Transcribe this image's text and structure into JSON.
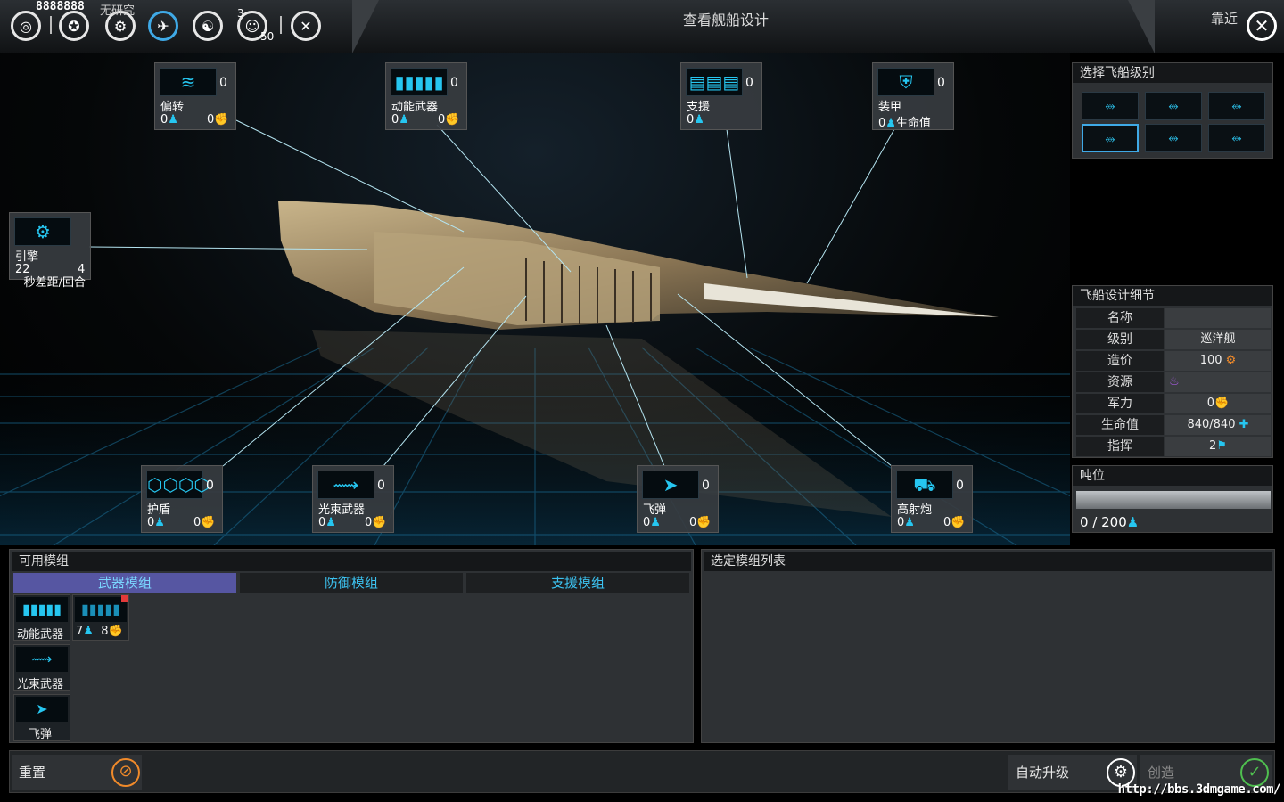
{
  "topbar": {
    "credits": "8888888",
    "research_label": "无研究",
    "badge_a": "3",
    "badge_b": "50",
    "title": "查看舰船设计",
    "approach": "靠近",
    "close_icon": "✕"
  },
  "slots": {
    "deflect": {
      "count": "0",
      "name": "偏转",
      "v1": "0",
      "v2": "0"
    },
    "kinetic": {
      "count": "0",
      "name": "动能武器",
      "v1": "0",
      "v2": "0"
    },
    "support": {
      "count": "0",
      "name": "支援",
      "v1": "0"
    },
    "armor": {
      "count": "0",
      "name": "装甲",
      "v1": "0",
      "v1_suffix": "生命值"
    },
    "engine": {
      "name": "引擎",
      "v1": "22",
      "v2": "4",
      "unit": "秒差距/回合"
    },
    "shield": {
      "count": "0",
      "name": "护盾",
      "v1": "0",
      "v2": "0"
    },
    "beam": {
      "count": "0",
      "name": "光束武器",
      "v1": "0",
      "v2": "0"
    },
    "missile": {
      "count": "0",
      "name": "飞弹",
      "v1": "0",
      "v2": "0"
    },
    "artillery": {
      "count": "0",
      "name": "高射炮",
      "v1": "0",
      "v2": "0"
    }
  },
  "ship_class": {
    "title": "选择飞船级别",
    "selected_index": 3
  },
  "details": {
    "title": "飞船设计细节",
    "rows": [
      {
        "label": "名称",
        "value": ""
      },
      {
        "label": "级别",
        "value": "巡洋舰"
      },
      {
        "label": "造价",
        "value": "100"
      },
      {
        "label": "资源",
        "value": ""
      },
      {
        "label": "军力",
        "value": "0"
      },
      {
        "label": "生命值",
        "value": "840/840"
      },
      {
        "label": "指挥",
        "value": "2"
      }
    ]
  },
  "tonnage": {
    "title": "吨位",
    "value": "0 / 200",
    "fill": 0
  },
  "modules": {
    "title": "可用模组",
    "tabs": [
      "武器模组",
      "防御模组",
      "支援模组"
    ],
    "active_tab": 0,
    "items": [
      {
        "label": "动能武器"
      },
      {
        "label": "",
        "v1": "7",
        "v2": "8"
      },
      {
        "label": "光束武器"
      },
      {
        "label": "飞弹"
      }
    ]
  },
  "selected_list": {
    "title": "选定模组列表"
  },
  "footer": {
    "reset": "重置",
    "auto_upgrade": "自动升级",
    "create": "创造"
  },
  "watermark": "http://bbs.3dmgame.com/",
  "colors": {
    "accent": "#26c6f0",
    "tab_active": "#5656a2",
    "panel": "#2e3134"
  }
}
